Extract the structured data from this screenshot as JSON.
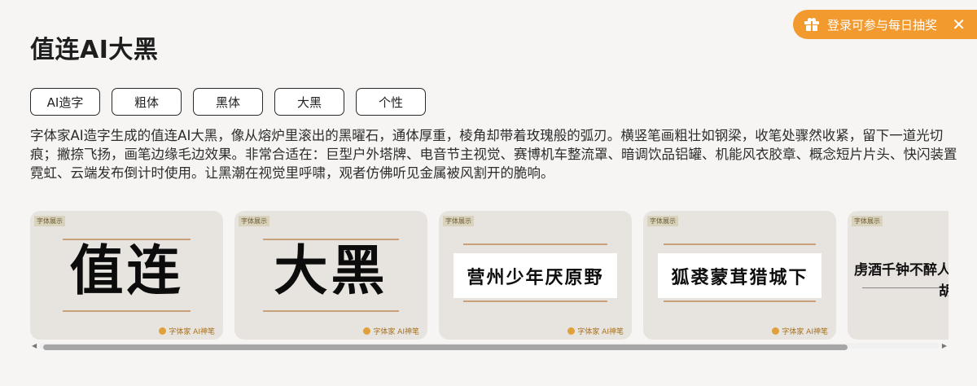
{
  "page": {
    "title": "值连AI大黑"
  },
  "tags": [
    "AI造字",
    "粗体",
    "黑体",
    "大黑",
    "个性"
  ],
  "description": "字体家AI造字生成的值连AI大黑，像从熔炉里滚出的黑曜石，通体厚重，棱角却带着玫瑰般的弧刃。横竖笔画粗壮如钢梁，收笔处骤然收紧，留下一道光切痕；撇捺飞扬，画笔边缘毛边效果。非常合适在：巨型户外塔牌、电音节主视觉、赛博机车整流罩、暗调饮品铝罐、机能风衣胶章、概念短片片头、快闪装置霓虹、云端发布倒计时使用。让黑潮在视觉里呼啸，观者仿佛听见金属被风割开的脆响。",
  "cards": [
    {
      "badge": "字体展示",
      "text": "值连",
      "logo": "字体家 AI神笔"
    },
    {
      "badge": "字体展示",
      "text": "大黑",
      "logo": "字体家 AI神笔"
    },
    {
      "badge": "字体展示",
      "text": "营州少年厌原野",
      "logo": "字体家 AI神笔"
    },
    {
      "badge": "字体展示",
      "text": "狐裘蒙茸猎城下",
      "logo": "字体家 AI神笔"
    },
    {
      "badge": "字体展示",
      "text": "虏酒千钟不醉人",
      "text2": "胡"
    }
  ],
  "scrollbar": {
    "left_arrow": "◀",
    "right_arrow": "▶"
  },
  "promo": {
    "label": "登录可参与每日抽奖",
    "close": "✕",
    "icon": "gift-icon"
  }
}
